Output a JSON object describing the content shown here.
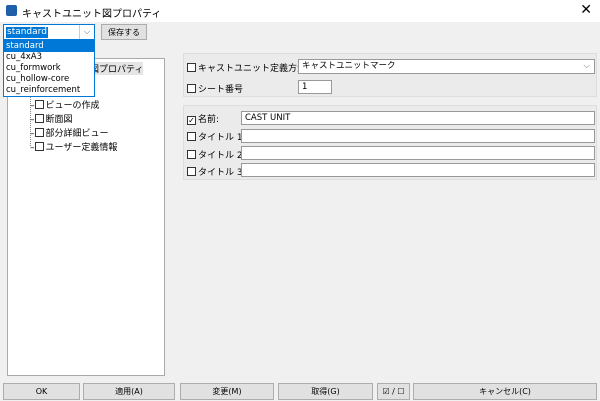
{
  "window": {
    "title": "キャストユニット図プロパティ",
    "close": "✕"
  },
  "toolbar": {
    "combo_value": "standard",
    "save_label": "保存する"
  },
  "dropdown": {
    "options": [
      "standard",
      "cu_4xA3",
      "cu_formwork",
      "cu_hollow-core",
      "cu_reinforcement"
    ]
  },
  "tree": {
    "root_label": "図プロパティ",
    "items": [
      "ビューの作成",
      "断面図",
      "部分詳細ビュー",
      "ユーザー定義情報"
    ]
  },
  "form": {
    "method_label": "キャストユニット定義方法",
    "method_value": "キャストユニットマーク",
    "sheet_label": "シート番号",
    "sheet_value": "1",
    "name_label": "名前:",
    "name_value": "CAST UNIT",
    "title1_label": "タイトル 1:",
    "title2_label": "タイトル 2:",
    "title3_label": "タイトル 3:"
  },
  "buttons": {
    "ok": "OK",
    "apply": "適用(A)",
    "modify": "変更(M)",
    "get": "取得(G)",
    "toggle": "☑ / ☐",
    "cancel": "キャンセル(C)"
  }
}
